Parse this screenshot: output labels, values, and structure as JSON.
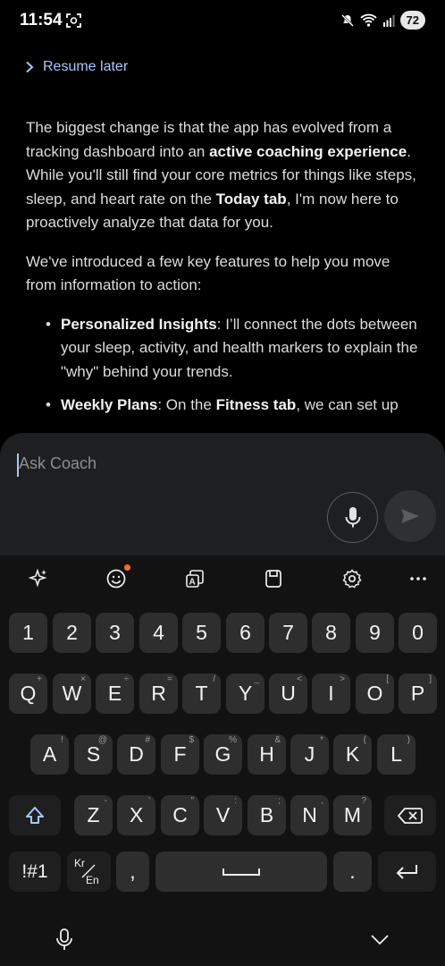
{
  "status_bar": {
    "time": "11:54",
    "battery": "72",
    "icons": [
      "screenshot-icon",
      "mute-icon",
      "wifi-icon",
      "signal-icon"
    ]
  },
  "chat": {
    "resume_label": "Resume later",
    "p1": {
      "t1": "The biggest change is that the app has evolved from a tracking dashboard into an ",
      "b1": "active coaching experience",
      "t2": ". While you'll still find your core metrics for things like steps, sleep, and heart rate on the ",
      "b2": "Today tab",
      "t3": ", I'm now here to proactively analyze that data for you."
    },
    "p2": "We've introduced a few key features to help you move from information to action:",
    "bullets": [
      {
        "bold": "Personalized Insights",
        "text": ": I’ll connect the dots between your sleep, activity, and health markers to explain the \"why\" behind your trends."
      },
      {
        "bold": "Weekly Plans",
        "text": ": On the ",
        "bold2": "Fitness tab",
        "text2": ", we can set up"
      }
    ]
  },
  "input": {
    "placeholder": "Ask Coach"
  },
  "keyboard": {
    "toolbar": [
      "sparkle-icon",
      "emoji-icon",
      "translate-icon",
      "clipboard-icon",
      "settings-icon",
      "more-icon"
    ],
    "row_numbers": [
      "1",
      "2",
      "3",
      "4",
      "5",
      "6",
      "7",
      "8",
      "9",
      "0"
    ],
    "row1": [
      {
        "k": "Q",
        "s": "+"
      },
      {
        "k": "W",
        "s": "×"
      },
      {
        "k": "E",
        "s": "÷"
      },
      {
        "k": "R",
        "s": "="
      },
      {
        "k": "T",
        "s": "/"
      },
      {
        "k": "Y",
        "s": "_"
      },
      {
        "k": "U",
        "s": "<"
      },
      {
        "k": "I",
        "s": ">"
      },
      {
        "k": "O",
        "s": "["
      },
      {
        "k": "P",
        "s": "]"
      }
    ],
    "row2": [
      {
        "k": "A",
        "s": "!"
      },
      {
        "k": "S",
        "s": "@"
      },
      {
        "k": "D",
        "s": "#"
      },
      {
        "k": "F",
        "s": "$"
      },
      {
        "k": "G",
        "s": "%"
      },
      {
        "k": "H",
        "s": "&"
      },
      {
        "k": "J",
        "s": "*"
      },
      {
        "k": "K",
        "s": "("
      },
      {
        "k": "L",
        "s": ")"
      }
    ],
    "row3": [
      {
        "k": "Z",
        "s": "-"
      },
      {
        "k": "X",
        "s": "'"
      },
      {
        "k": "C",
        "s": "\""
      },
      {
        "k": "V",
        "s": ":"
      },
      {
        "k": "B",
        "s": ";"
      },
      {
        "k": "N",
        "s": ","
      },
      {
        "k": "M",
        "s": "?"
      }
    ],
    "symbols_label": "!#1",
    "lang_top": "Kr",
    "lang_bottom": "En",
    "comma": ",",
    "period": "."
  },
  "colors": {
    "accent": "#a8c7fa",
    "panel": "#1e1f20",
    "key": "#2e2e2e",
    "notification_dot": "#ff6a2b"
  }
}
